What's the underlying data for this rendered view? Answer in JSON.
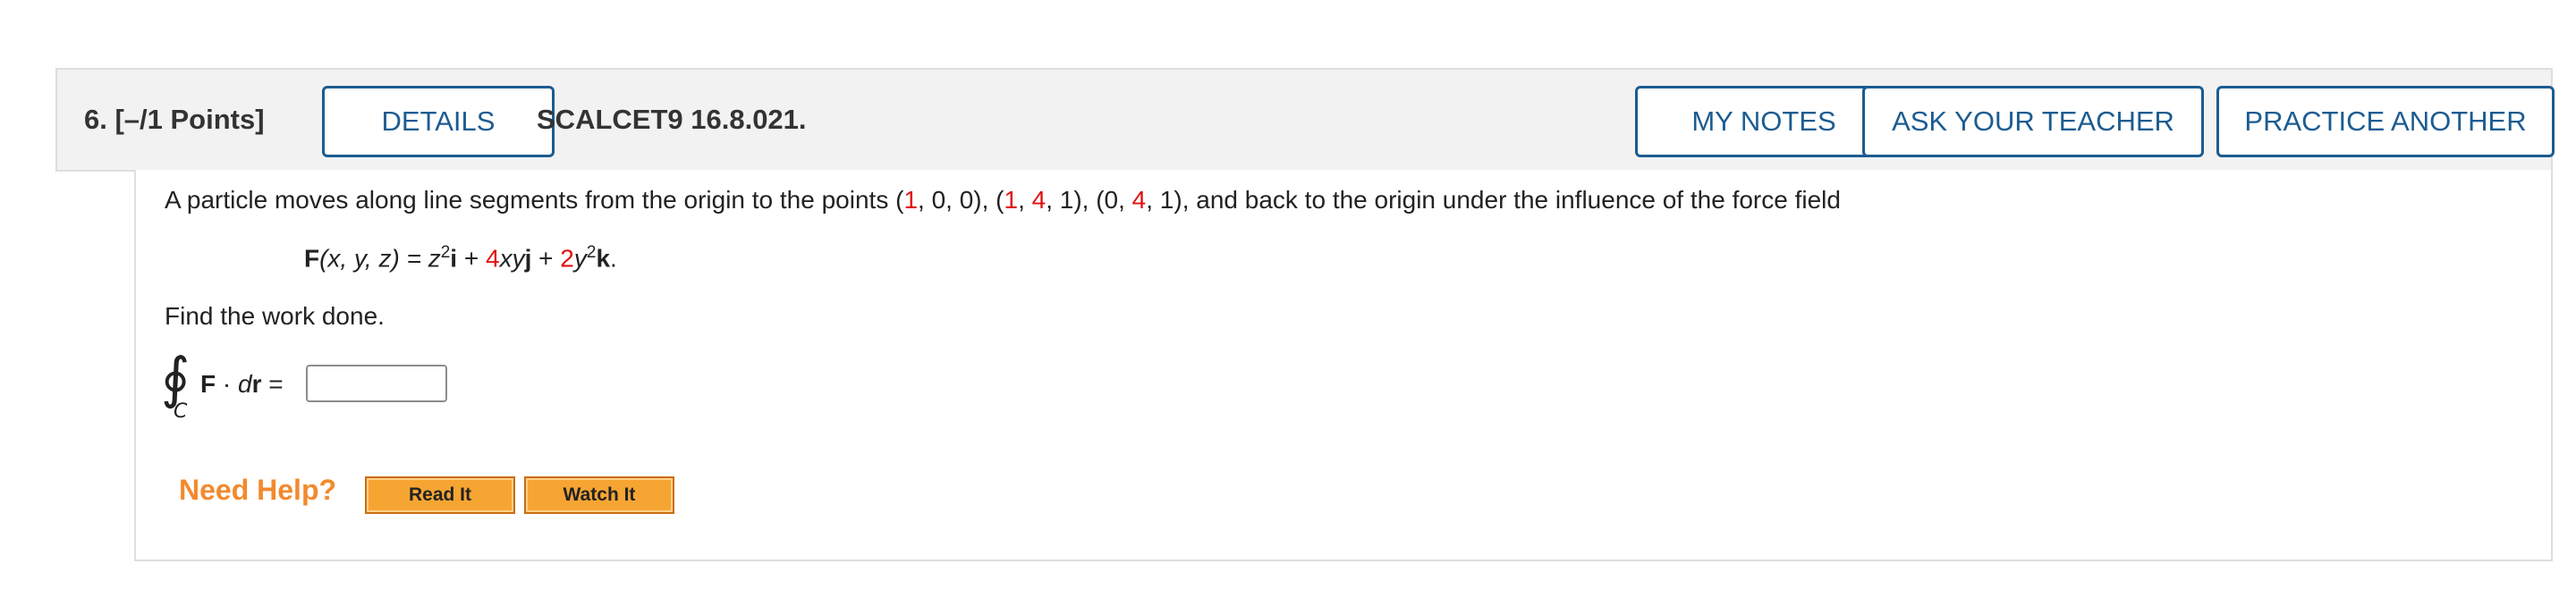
{
  "header": {
    "question_label": "6.  [–/1 Points]",
    "details_label": "DETAILS",
    "course_code": "SCALCET9 16.8.021.",
    "my_notes_label": "MY NOTES",
    "ask_teacher_label": "ASK YOUR TEACHER",
    "practice_another_label": "PRACTICE ANOTHER"
  },
  "problem": {
    "intro_1": "A particle moves along line segments from the origin to the points (",
    "p1_x": "1",
    "sep_1": ", 0, 0), (",
    "p2_x": "1",
    "sep_2": ", ",
    "p2_y": "4",
    "sep_3": ", 1), (0, ",
    "p3_y": "4",
    "intro_end": ", 1), and back to the origin under the influence of the force field",
    "force_lhs_bold": "F",
    "force_lhs_args": "(x, y, z) = z",
    "exp_1": "2",
    "unit_i": "i",
    "plus_1": " + ",
    "coef_xy": "4",
    "term_xy": "xy",
    "unit_j": "j",
    "plus_2": " + ",
    "coef_y2": "2",
    "term_y": "y",
    "exp_2": "2",
    "unit_k": "k",
    "period": ".",
    "find_text": "Find the work done.",
    "integral_symbol": "∮",
    "integral_sub": "C",
    "integrand_F": "F",
    "integrand_dot": " · ",
    "integrand_d": "d",
    "integrand_r": "r",
    "integrand_eq": " =",
    "answer_value": ""
  },
  "help": {
    "need_help_label": "Need Help?",
    "read_it_label": "Read It",
    "watch_it_label": "Watch It"
  },
  "colors": {
    "accent": "#1c5c91",
    "highlight_red": "#e01010",
    "need_help_orange": "#f28a2e",
    "help_button_fill": "#f6a533"
  }
}
